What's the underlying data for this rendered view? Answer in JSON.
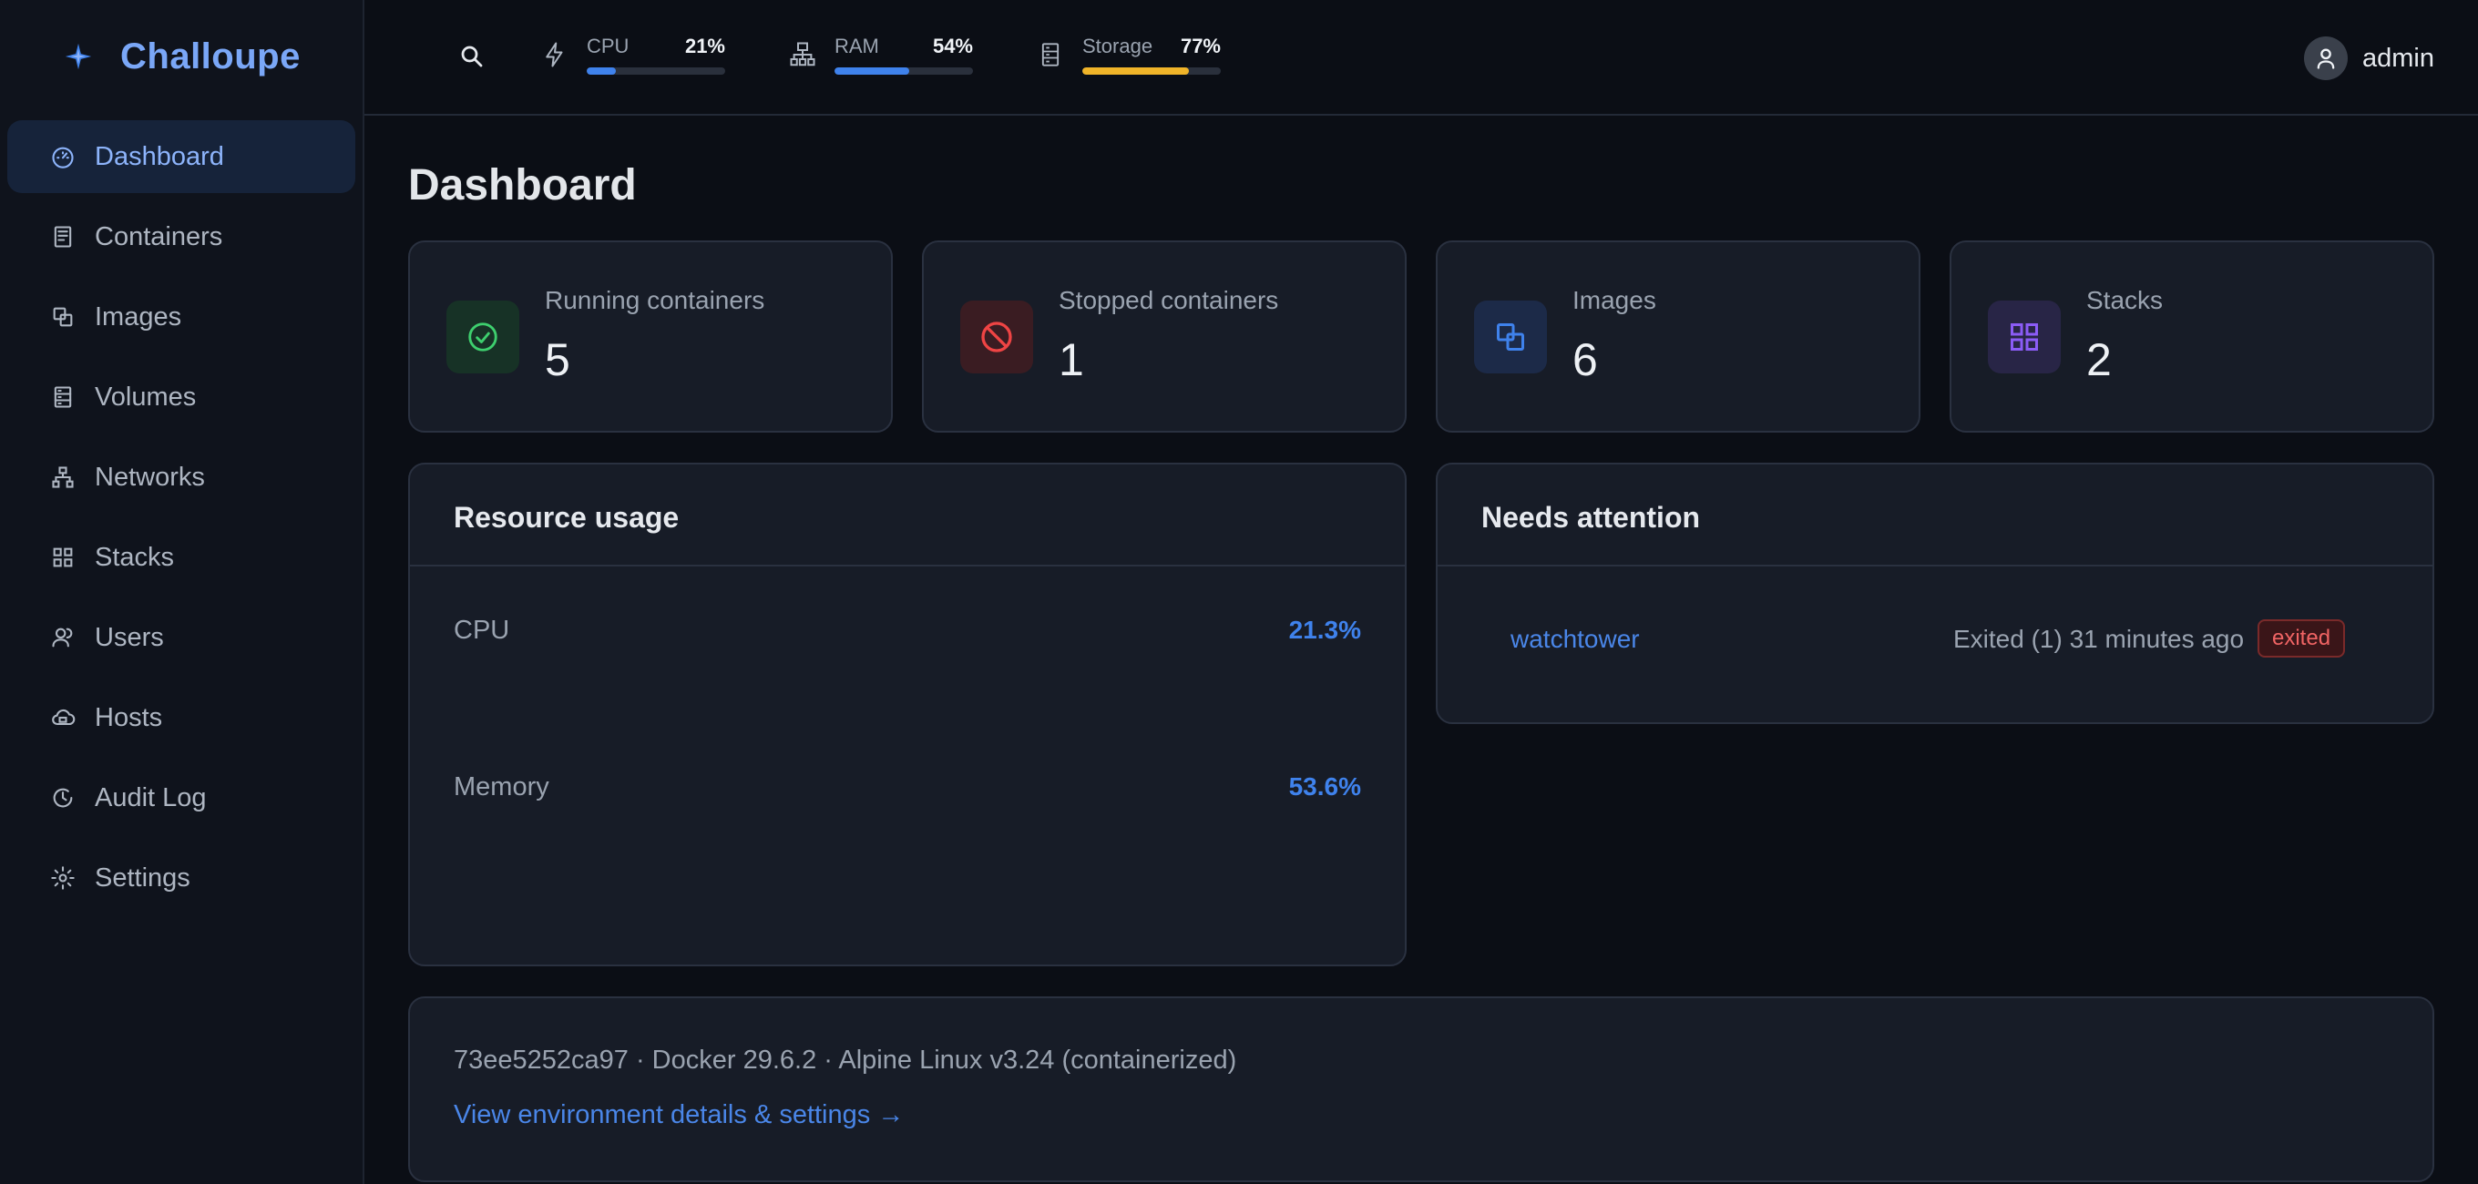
{
  "app": {
    "name": "Challoupe",
    "accent": "#7aa7f7"
  },
  "sidebar": {
    "items": [
      {
        "label": "Dashboard",
        "icon": "dashboard-gauge-icon",
        "active": true
      },
      {
        "label": "Containers",
        "icon": "container-icon"
      },
      {
        "label": "Images",
        "icon": "images-icon"
      },
      {
        "label": "Volumes",
        "icon": "volumes-icon"
      },
      {
        "label": "Networks",
        "icon": "network-icon"
      },
      {
        "label": "Stacks",
        "icon": "stacks-grid-icon"
      },
      {
        "label": "Users",
        "icon": "users-icon"
      },
      {
        "label": "Hosts",
        "icon": "hosts-cloud-icon"
      },
      {
        "label": "Audit Log",
        "icon": "history-icon"
      },
      {
        "label": "Settings",
        "icon": "gear-icon"
      }
    ]
  },
  "topbar": {
    "search_icon": "search-icon",
    "metrics": [
      {
        "label": "CPU",
        "value": "21%",
        "fraction": 0.21,
        "color": "#3f82ec",
        "icon": "lightning-icon"
      },
      {
        "label": "RAM",
        "value": "54%",
        "fraction": 0.54,
        "color": "#3f82ec",
        "icon": "network-icon"
      },
      {
        "label": "Storage",
        "value": "77%",
        "fraction": 0.77,
        "color": "#f0b429",
        "icon": "storage-icon"
      }
    ],
    "user": {
      "name": "admin",
      "icon": "user-avatar-icon"
    }
  },
  "main": {
    "title": "Dashboard",
    "stats": [
      {
        "label": "Running containers",
        "value": "5",
        "icon": "check-circle-icon",
        "color": "#3ecf6e"
      },
      {
        "label": "Stopped containers",
        "value": "1",
        "icon": "blocked-circle-icon",
        "color": "#ef4444"
      },
      {
        "label": "Images",
        "value": "6",
        "icon": "images-icon",
        "color": "#3f82ec"
      },
      {
        "label": "Stacks",
        "value": "2",
        "icon": "stacks-grid-icon",
        "color": "#8b5cf6"
      }
    ],
    "resource_usage": {
      "title": "Resource usage",
      "rows": [
        {
          "label": "CPU",
          "value": "21.3%"
        },
        {
          "label": "Memory",
          "value": "53.6%"
        }
      ]
    },
    "needs_attention": {
      "title": "Needs attention",
      "items": [
        {
          "name": "watchtower",
          "status": "Exited (1) 31 minutes ago",
          "badge": "exited"
        }
      ]
    },
    "environment": {
      "summary": "73ee5252ca97 · Docker 29.6.2 · Alpine Linux v3.24 (containerized)",
      "link": "View environment details & settings →"
    }
  }
}
